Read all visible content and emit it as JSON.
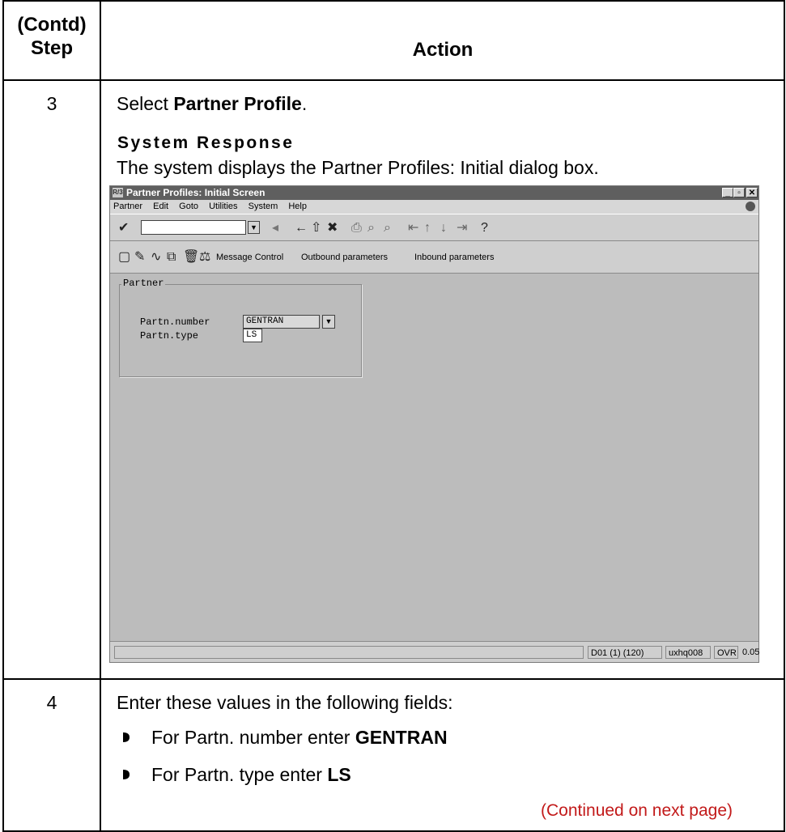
{
  "table": {
    "header_step_line1": "(Contd)",
    "header_step_line2": "Step",
    "header_action": "Action"
  },
  "rows": [
    {
      "step": "3",
      "select_prefix": "Select ",
      "select_bold": "Partner Profile",
      "select_suffix": ".",
      "system_response_heading": "System Response",
      "system_response_text": "The system displays the Partner Profiles: Initial dialog box."
    },
    {
      "step": "4",
      "intro": "Enter these values in the following fields:",
      "bullets": [
        {
          "prefix": "For Partn. number enter ",
          "bold": "GENTRAN"
        },
        {
          "prefix": "For Partn. type enter ",
          "bold": "LS"
        }
      ],
      "continued": "(Continued on next page)"
    }
  ],
  "sap_window": {
    "app_icon": "R/3",
    "title": "Partner Profiles: Initial Screen",
    "menu": [
      "Partner",
      "Edit",
      "Goto",
      "Utilities",
      "System",
      "Help"
    ],
    "toolbar2_items": [
      "Message Control",
      "Outbound parameters",
      "Inbound parameters"
    ],
    "group_label": "Partner",
    "fields": [
      {
        "label": "Partn.number",
        "value": "GENTRAN"
      },
      {
        "label": "Partn.type",
        "value": "LS"
      }
    ],
    "status": [
      "D01 (1) (120)",
      "uxhq008",
      "OVR",
      "0.05"
    ]
  },
  "colors": {
    "continued_text": "#c21a1a",
    "window_bg": "#bcbcbc",
    "titlebar": "#5f5f5f"
  }
}
